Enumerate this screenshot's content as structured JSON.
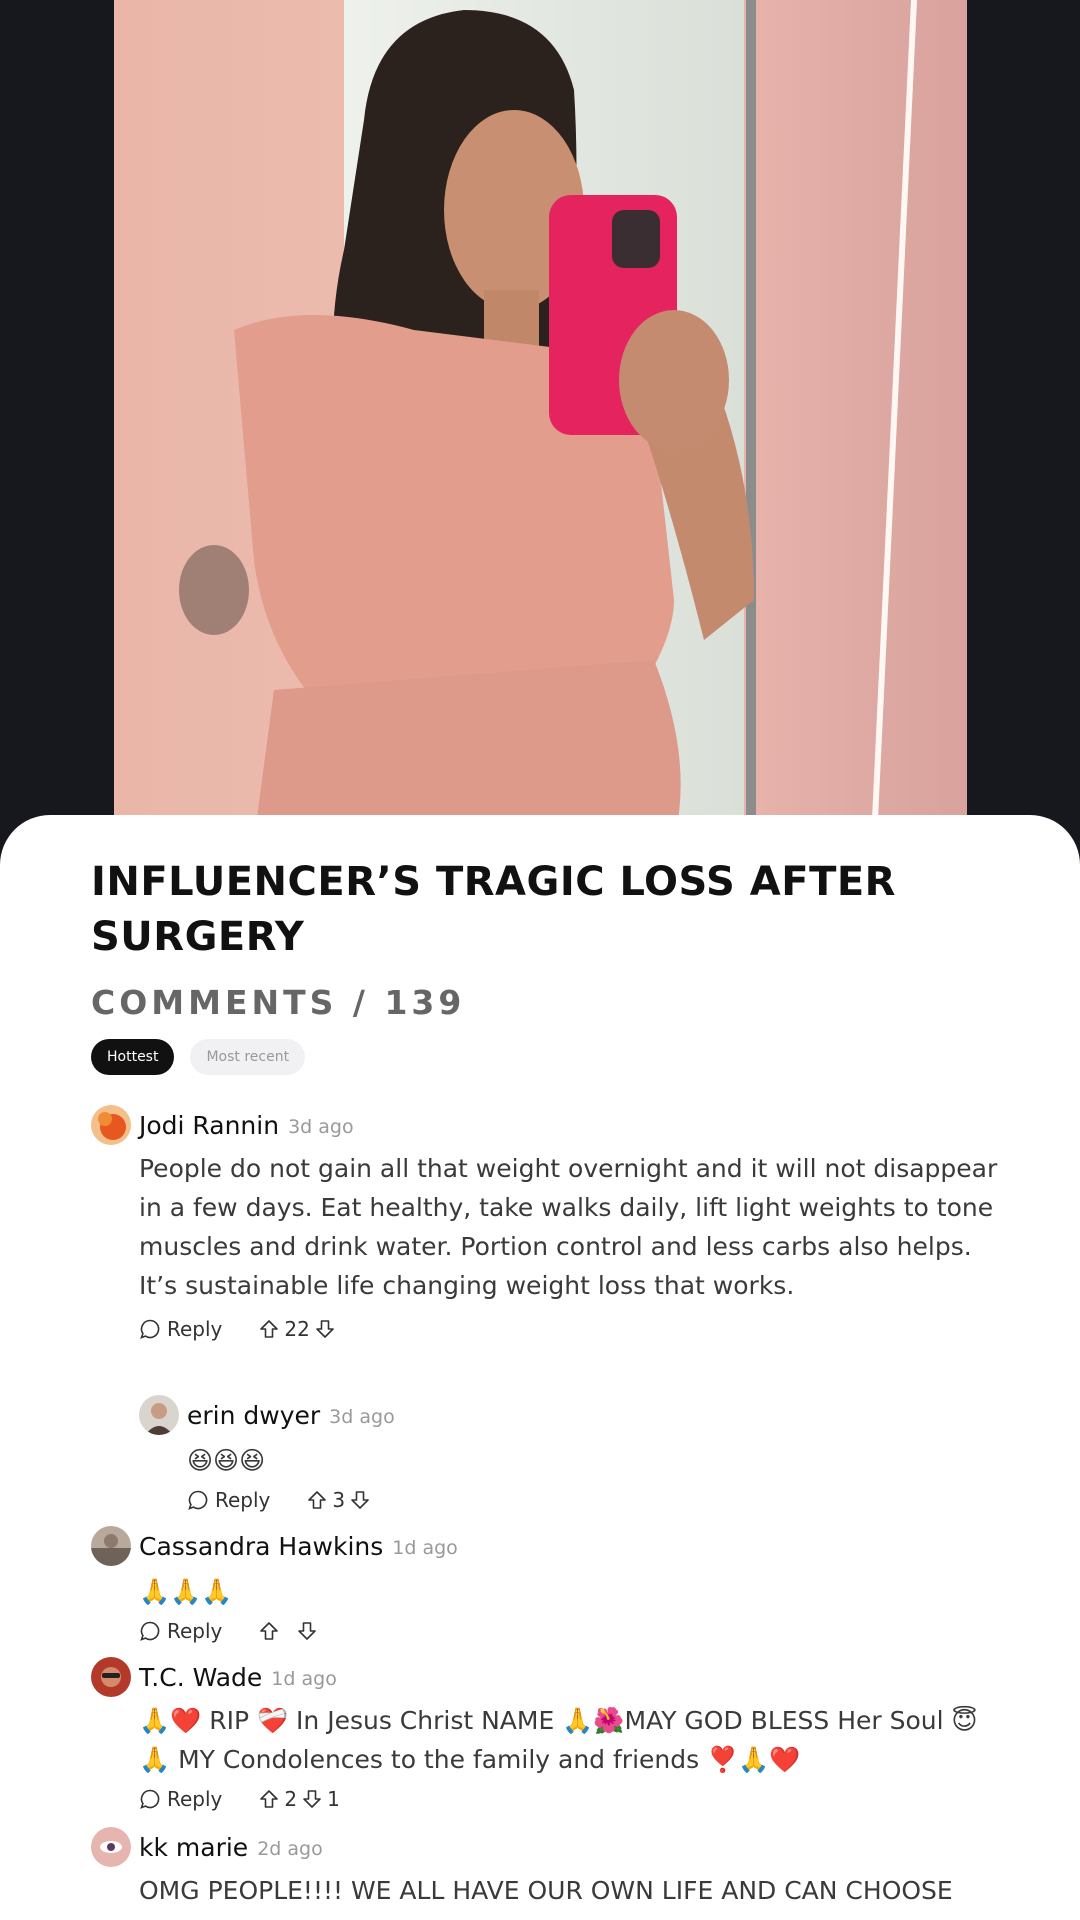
{
  "article": {
    "headline": "INFLUENCER’S TRAGIC LOSS AFTER SURGERY"
  },
  "comments_header": {
    "label": "COMMENTS",
    "separator": "/",
    "count": "139"
  },
  "sort_tabs": [
    {
      "label": "Hottest",
      "active": true
    },
    {
      "label": "Most recent",
      "active": false
    }
  ],
  "comments": [
    {
      "author": "Jodi Rannin",
      "time": "3d ago",
      "text": "People do not gain all that weight overnight and it will not disappear in a few days. Eat healthy, take walks daily, lift light weights to tone muscles and drink water. Portion control and less carbs also helps. It’s sustainable life changing weight loss that works.",
      "reply_label": "Reply",
      "upvotes": "22",
      "downvotes": ""
    },
    {
      "author": "erin dwyer",
      "time": "3d ago",
      "text": "😆😆😆",
      "reply_label": "Reply",
      "upvotes": "3",
      "downvotes": ""
    },
    {
      "author": "Cassandra Hawkins",
      "time": "1d ago",
      "text": "🙏🙏🙏",
      "reply_label": "Reply",
      "upvotes": "",
      "downvotes": ""
    },
    {
      "author": "T.C. Wade",
      "time": "1d ago",
      "text": "🙏❤️ RIP ❤️‍🩹 In Jesus Christ NAME 🙏🌺MAY GOD BLESS Her Soul 😇🙏 MY Condolences to the family and friends ❣️🙏❤️",
      "reply_label": "Reply",
      "upvotes": "2",
      "downvotes": "1"
    },
    {
      "author": "kk marie",
      "time": "2d ago",
      "text": "OMG PEOPLE!!!! WE ALL HAVE OUR OWN LIFE AND CAN CHOOSE"
    }
  ],
  "icons": {
    "reply": "speech-bubble-icon",
    "upvote": "arrow-up-icon",
    "downvote": "arrow-down-icon"
  },
  "colors": {
    "background_dark": "#16181d",
    "active_tab": "#111111",
    "inactive_tab": "#f1f1f3",
    "muted_text": "#999999"
  }
}
